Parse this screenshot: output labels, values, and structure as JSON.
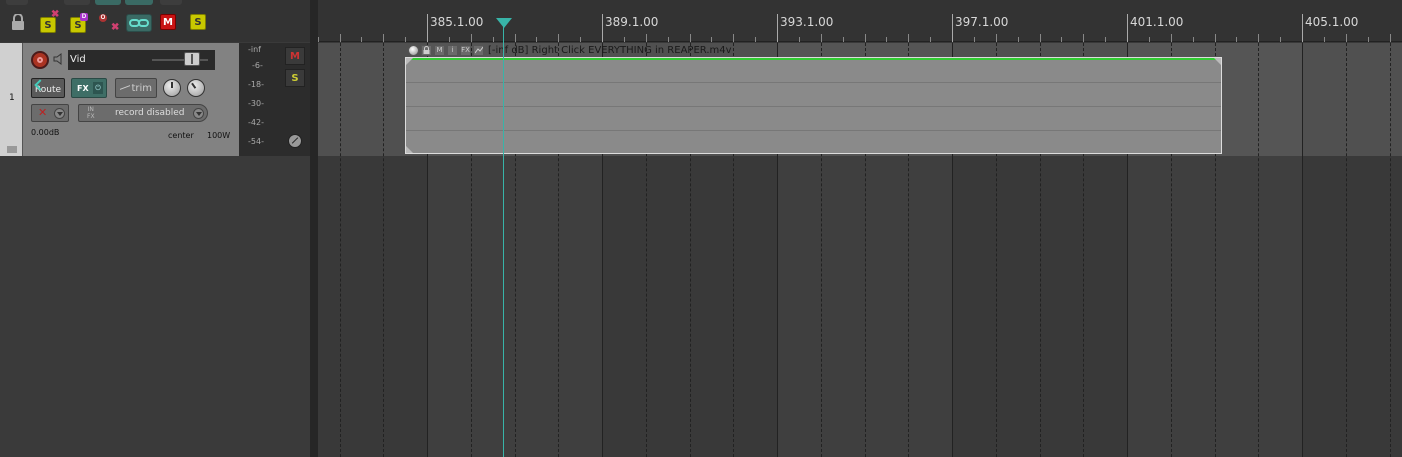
{
  "toolbar": {
    "solo_label": "S",
    "mute_label": "M",
    "solo2_label": "S",
    "badge_d": "D",
    "badge_o": "O"
  },
  "track": {
    "number": "1",
    "name": "Vid",
    "route_label": "Route",
    "fx_label": "FX",
    "fx_bypass_label": "⏻",
    "trim_label": "trim",
    "input_in_label": "IN",
    "input_fx_label": "FX",
    "record_mode": "record disabled",
    "volume": "0.00dB",
    "pan": "center",
    "width": "100W",
    "meter_mute": "M",
    "meter_solo": "S",
    "meter_scale": [
      "-inf",
      "-6-",
      "-18-",
      "-30-",
      "-42-",
      "-54-"
    ]
  },
  "timeline": {
    "markers": [
      "385.1.00",
      "389.1.00",
      "393.1.00",
      "397.1.00",
      "401.1.00",
      "405.1.00"
    ]
  },
  "media_item": {
    "title": "[-inf dB] Right Click EVERYTHING in REAPER.m4v",
    "header_icons": [
      "M",
      "i",
      "FX"
    ]
  },
  "colors": {
    "playhead": "#38b4a8",
    "item_top": "#33cc33",
    "solo": "#c8c800",
    "mute": "#c81414"
  }
}
